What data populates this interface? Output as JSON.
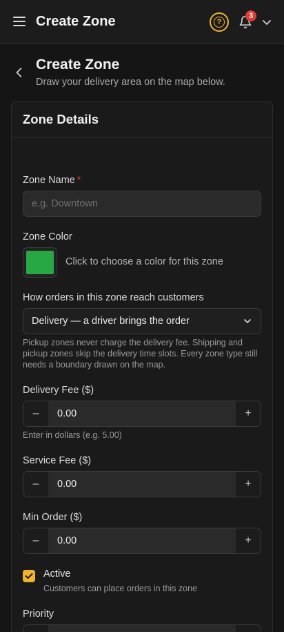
{
  "header": {
    "app_title": "Create Zone",
    "notification_count": "3",
    "accent_color": "#f0b429"
  },
  "page": {
    "title": "Create Zone",
    "subtitle": "Draw your delivery area on the map below."
  },
  "card": {
    "title": "Zone Details"
  },
  "form": {
    "zone_name": {
      "label": "Zone Name",
      "required_marker": "*",
      "value": "",
      "placeholder": "e.g. Downtown"
    },
    "zone_color": {
      "label": "Zone Color",
      "value": "#28a745",
      "hint": "Click to choose a color for this zone"
    },
    "fulfillment": {
      "label": "How orders in this zone reach customers",
      "selected": "Delivery — a driver brings the order",
      "help": "Pickup zones never charge the delivery fee. Shipping and pickup zones skip the delivery time slots. Every zone type still needs a boundary drawn on the map."
    },
    "delivery_fee": {
      "label": "Delivery Fee ($)",
      "value": "0.00",
      "help": "Enter in dollars (e.g. 5.00)"
    },
    "service_fee": {
      "label": "Service Fee ($)",
      "value": "0.00"
    },
    "min_order": {
      "label": "Min Order ($)",
      "value": "0.00"
    },
    "active": {
      "label": "Active",
      "description": "Customers can place orders in this zone",
      "checked": true
    },
    "priority": {
      "label": "Priority"
    }
  },
  "stepper": {
    "minus": "–",
    "plus": "+"
  }
}
